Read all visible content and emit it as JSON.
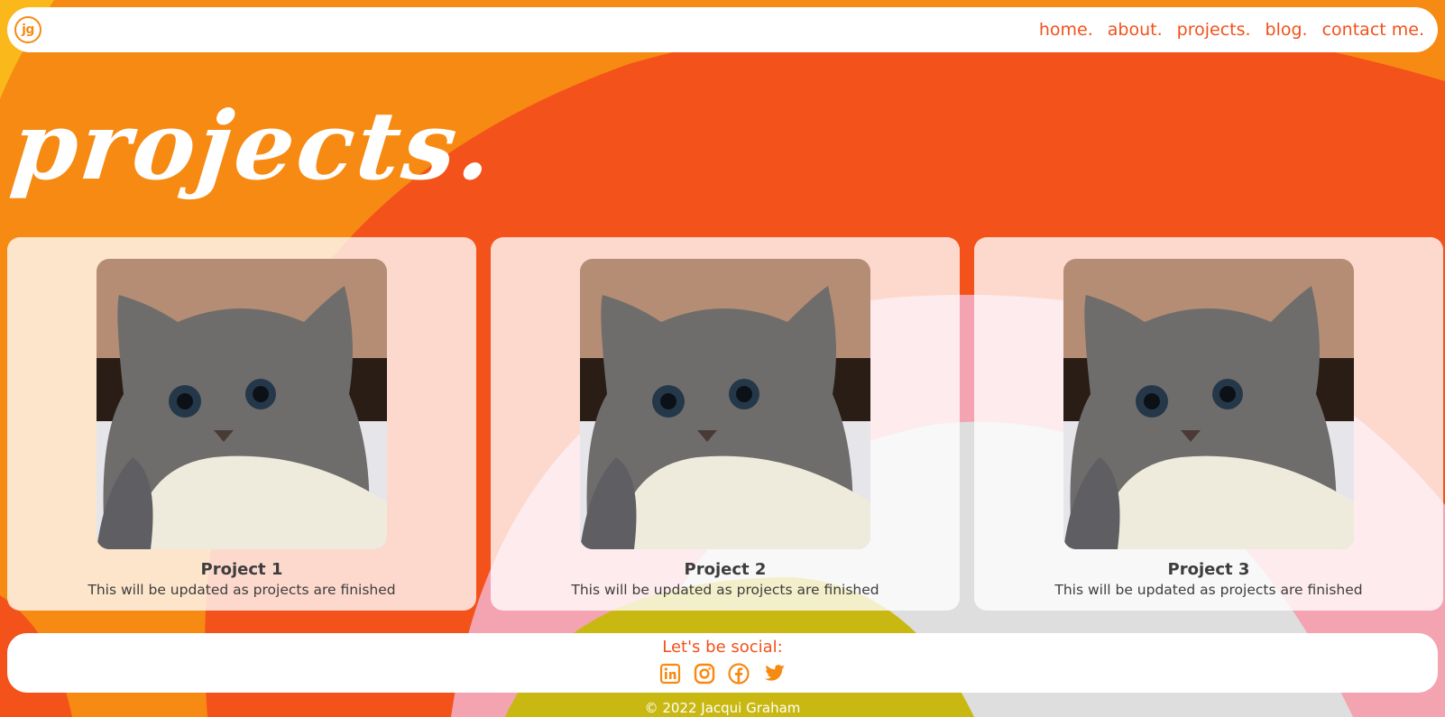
{
  "nav": {
    "logo_text": "jg",
    "links": [
      "home.",
      "about.",
      "projects.",
      "blog.",
      "contact me."
    ]
  },
  "page": {
    "title": "projects."
  },
  "projects": [
    {
      "title": "Project 1",
      "description": "This will be updated as projects are finished",
      "image": "kitten-photo"
    },
    {
      "title": "Project 2",
      "description": "This will be updated as projects are finished",
      "image": "kitten-photo"
    },
    {
      "title": "Project 3",
      "description": "This will be updated as projects are finished",
      "image": "kitten-photo"
    }
  ],
  "social": {
    "heading": "Let's be social:",
    "icons": [
      "linkedin-icon",
      "instagram-icon",
      "facebook-icon",
      "twitter-icon"
    ]
  },
  "footer": {
    "text": "© 2022 Jacqui Graham"
  },
  "colors": {
    "accent_orange": "#f68a12",
    "accent_red": "#f2511b",
    "text_dark": "#3d3d3d"
  }
}
